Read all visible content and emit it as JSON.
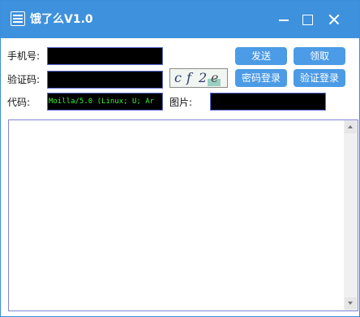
{
  "window": {
    "title": "饿了么V1.0",
    "accent": "#3e91dc"
  },
  "form": {
    "phone_label": "手机号:",
    "captcha_label": "验证码:",
    "code_label": "代码:",
    "image_label": "图片:",
    "code_value": "Moilla/5.0 (Linux; U; Ar",
    "captcha_text": "cf2e"
  },
  "buttons": {
    "send": "发送",
    "claim": "领取",
    "password_login": "密码登录",
    "verify_login": "验证登录"
  },
  "icons": [
    "app-icon",
    "minimize-icon",
    "maximize-icon",
    "close-icon",
    "scroll-up-icon",
    "scroll-down-icon"
  ]
}
